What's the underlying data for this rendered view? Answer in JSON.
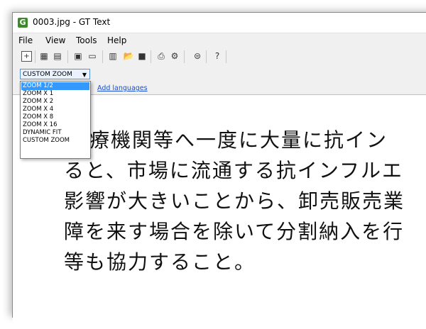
{
  "window": {
    "title": "0003.jpg - GT Text",
    "app_icon": "G"
  },
  "menu": [
    "File",
    "View",
    "Tools",
    "Help"
  ],
  "toolbar": {
    "icons": [
      "zoom-in-icon",
      "text-icon",
      "document-icon",
      "page-icon",
      "rectangle-icon",
      "paste-icon",
      "open-folder-icon",
      "save-icon",
      "print-icon",
      "settings-icon",
      "globe-icon",
      "help-icon"
    ],
    "glyphs": [
      "+",
      "▦",
      "▤",
      "▣",
      "▭",
      "▥",
      "📂",
      "■",
      "⎙",
      "⚙",
      "⊜",
      "?"
    ]
  },
  "zoom": {
    "selected": "CUSTOM ZOOM",
    "options": [
      "ZOOM 1/2",
      "ZOOM X 1",
      "ZOOM X 2",
      "ZOOM X 4",
      "ZOOM X 8",
      "ZOOM X 16",
      "DYNAMIC FIT",
      "CUSTOM ZOOM"
    ],
    "highlighted_index": 0
  },
  "add_languages": "Add languages",
  "document": {
    "lines": [
      "医療機関等へ一度に大量に抗イン",
      "ると、市場に流通する抗インフルエ",
      "影響が大きいことから、卸売販売業",
      "障を来す場合を除いて分割納入を行",
      "等も協力すること。"
    ]
  },
  "colors": {
    "highlight": "#3399ff",
    "link": "#1a4fd0"
  }
}
